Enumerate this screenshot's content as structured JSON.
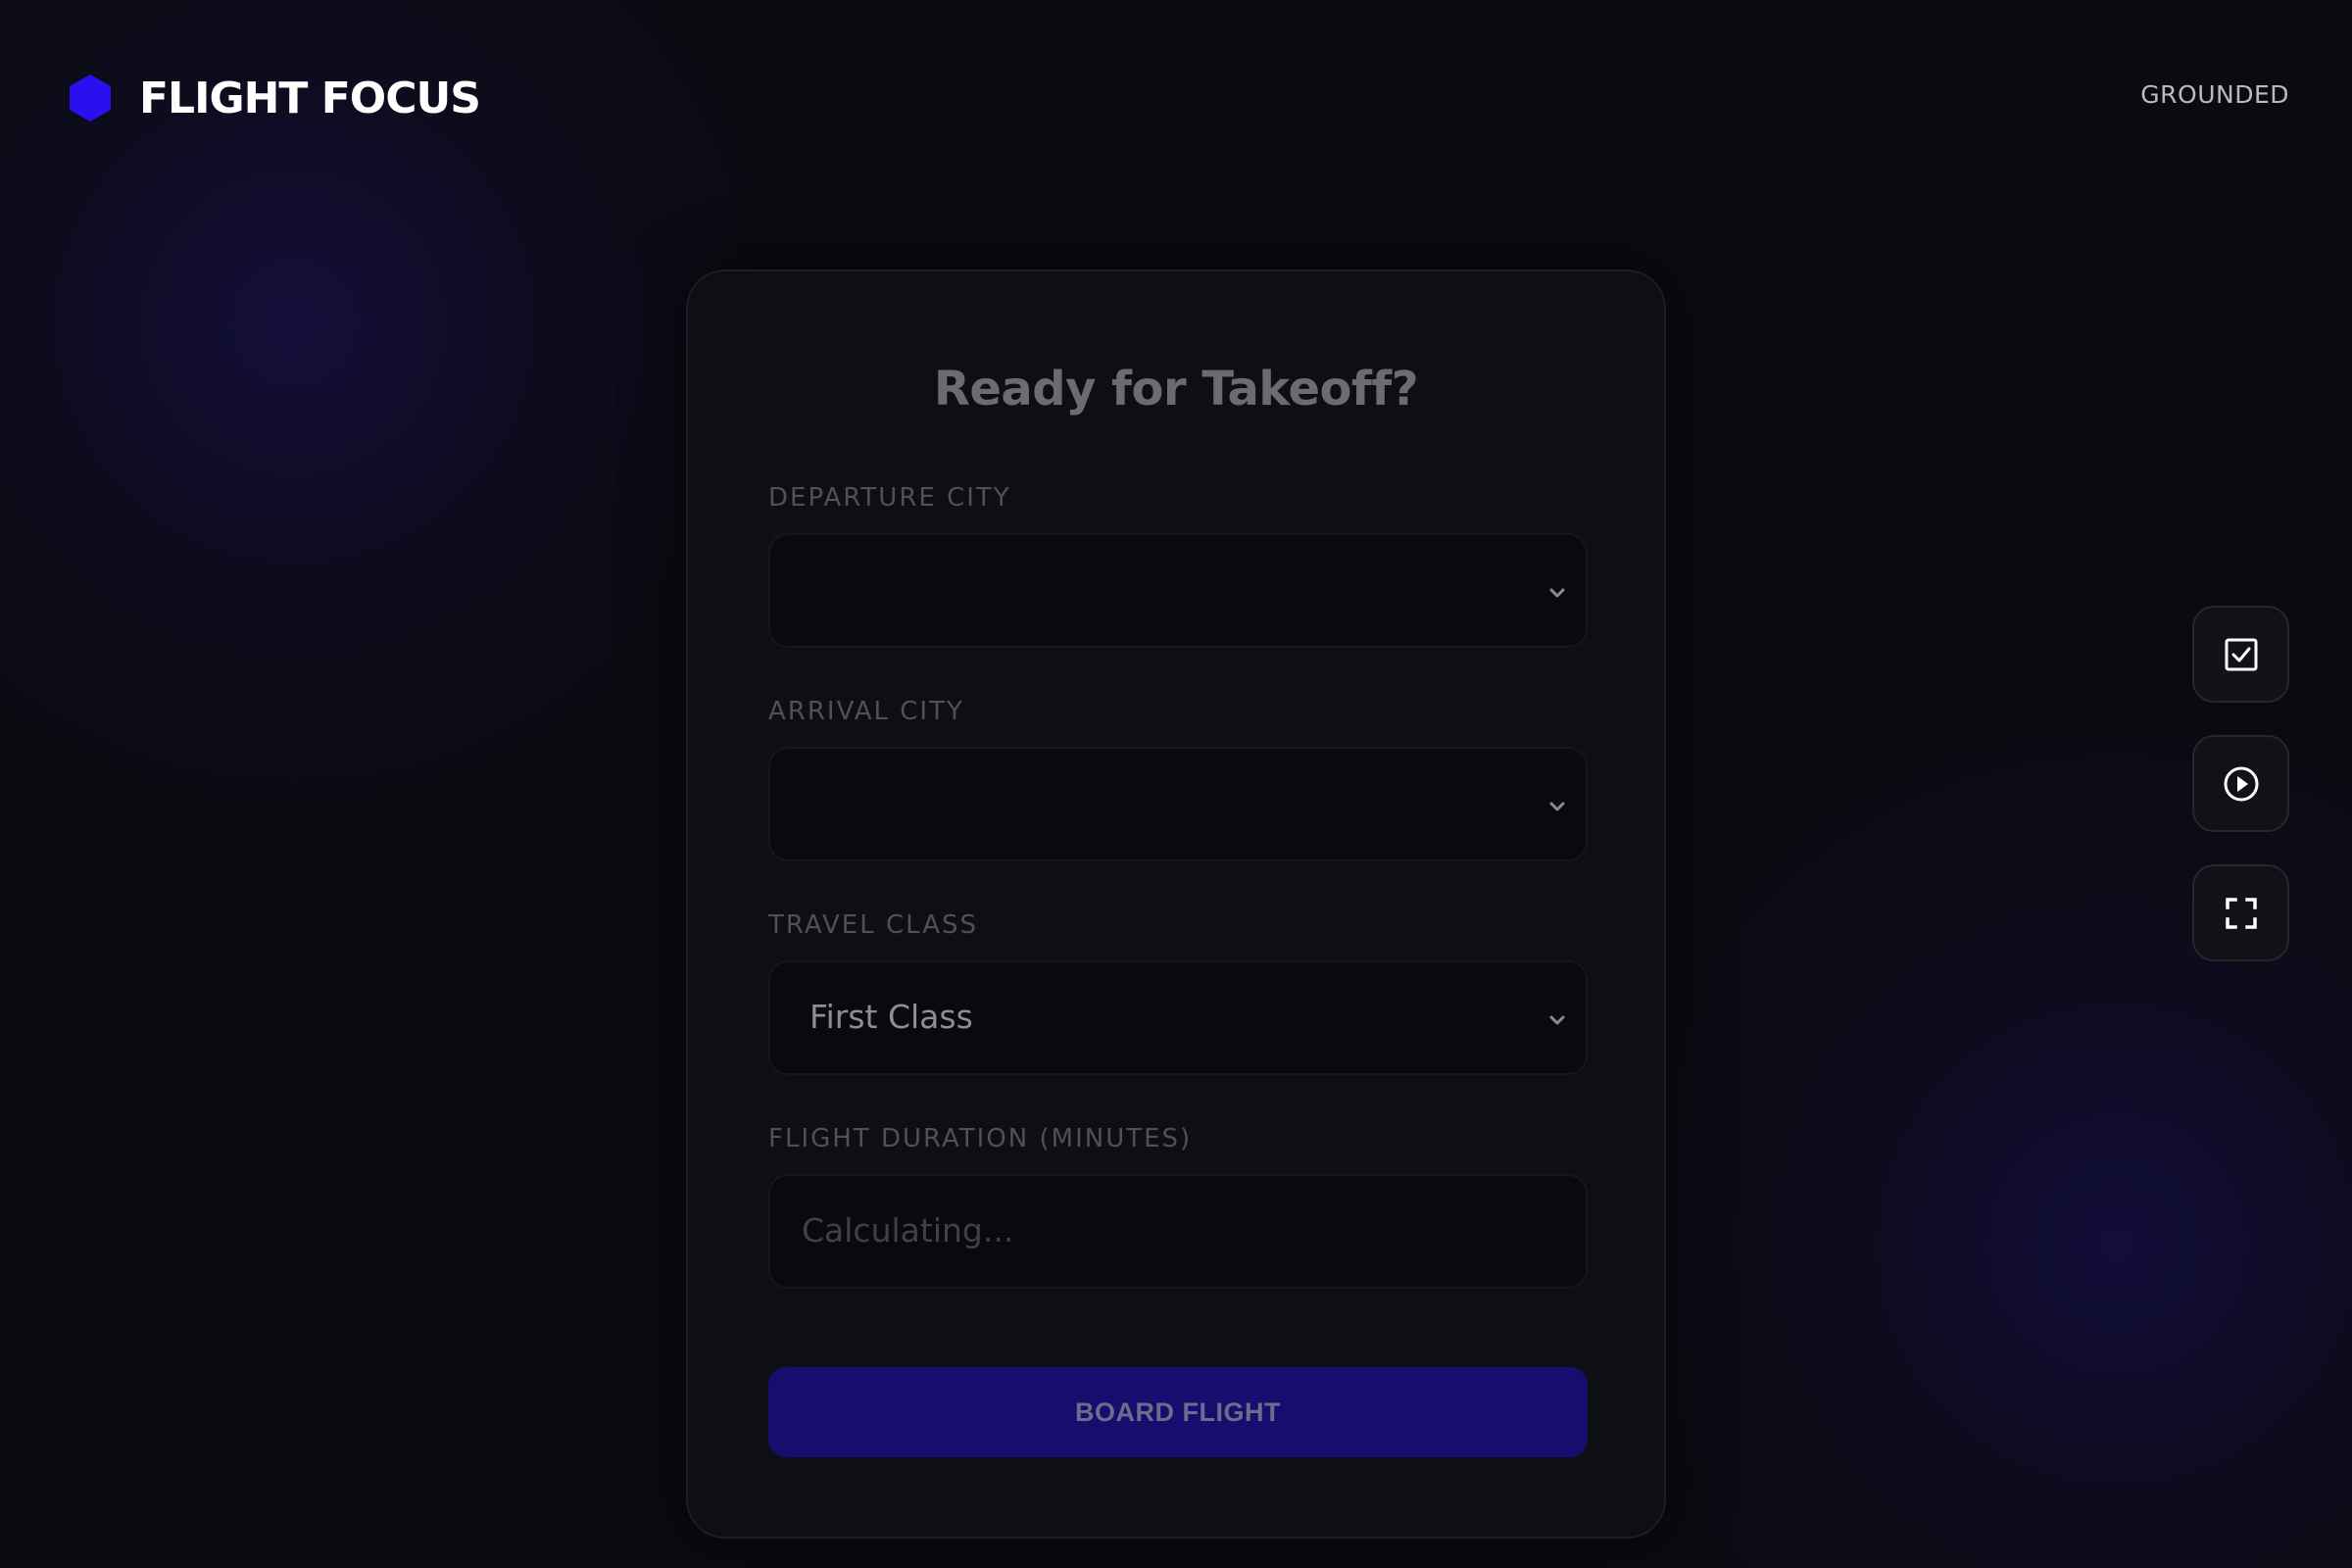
{
  "header": {
    "app_title": "FLIGHT FOCUS",
    "logo_icon": "hexagon-logo-icon",
    "logo_color": "#2a0ff0",
    "status": "GROUNDED"
  },
  "form": {
    "title": "Ready for Takeoff?",
    "departure": {
      "label": "DEPARTURE CITY",
      "value": ""
    },
    "arrival": {
      "label": "ARRIVAL CITY",
      "value": ""
    },
    "travel_class": {
      "label": "TRAVEL CLASS",
      "value": "First Class"
    },
    "duration": {
      "label": "FLIGHT DURATION (MINUTES)",
      "placeholder": "Calculating..."
    },
    "submit_label": "BOARD FLIGHT",
    "submit_color": "#160d6e"
  },
  "side_controls": [
    {
      "icon": "checkbox-icon"
    },
    {
      "icon": "play-circle-icon"
    },
    {
      "icon": "fullscreen-icon"
    }
  ]
}
